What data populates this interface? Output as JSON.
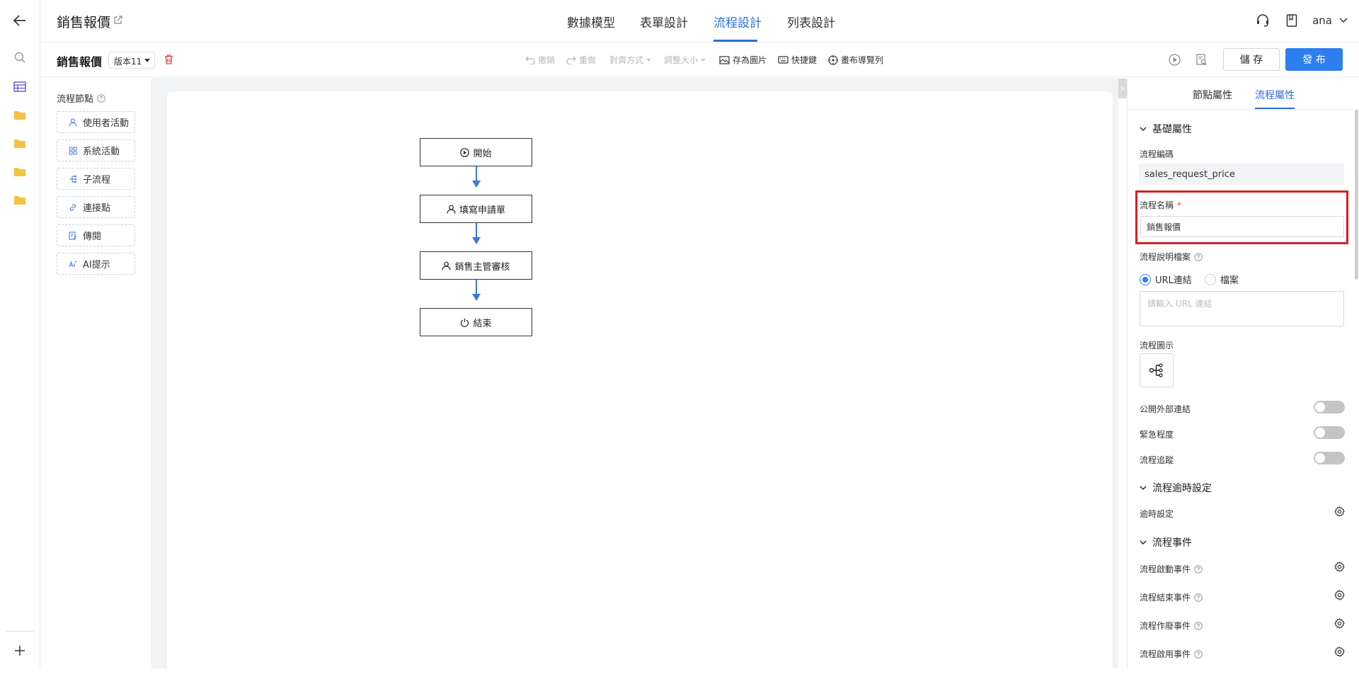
{
  "app": {
    "title": "銷售報價"
  },
  "main_tabs": [
    {
      "label": "數據模型"
    },
    {
      "label": "表單設計"
    },
    {
      "label": "流程設計"
    },
    {
      "label": "列表設計"
    }
  ],
  "user": {
    "name": "ana"
  },
  "toolbar": {
    "doc_title": "銷售報價",
    "version": "版本11",
    "undo": "撤銷",
    "redo": "重做",
    "align": "對齊方式",
    "resize": "調整大小",
    "save_image": "存為圖片",
    "shortcuts": "快捷鍵",
    "canvas_nav": "畫布導覽列",
    "save": "儲 存",
    "publish": "發 布"
  },
  "palette": {
    "title": "流程節點",
    "items": [
      {
        "label": "使用者活動"
      },
      {
        "label": "系統活動"
      },
      {
        "label": "子流程"
      },
      {
        "label": "連接點"
      },
      {
        "label": "傳閱"
      },
      {
        "label": "AI提示"
      }
    ]
  },
  "flow": {
    "nodes": [
      {
        "label": "開始"
      },
      {
        "label": "填寫申請單"
      },
      {
        "label": "銷售主管審核"
      },
      {
        "label": "結束"
      }
    ]
  },
  "panel": {
    "tabs": [
      {
        "label": "節點屬性"
      },
      {
        "label": "流程屬性"
      }
    ],
    "basic_section": "基礎屬性",
    "code_label": "流程編碼",
    "code_value": "sales_request_price",
    "name_label": "流程名稱",
    "name_required": "*",
    "name_value": "銷售報價",
    "doc_label": "流程說明檔案",
    "radio_url": "URL連結",
    "radio_file": "檔案",
    "url_placeholder": "請輸入 URL 連結",
    "icon_label": "流程圖示",
    "public_link": "公開外部連結",
    "urgency": "緊急程度",
    "tracking": "流程追蹤",
    "timeout_section": "流程逾時設定",
    "timeout_setting": "逾時設定",
    "events_section": "流程事件",
    "event_start": "流程啟動事件",
    "event_end": "流程結束事件",
    "event_void": "流程作廢事件",
    "event_enable": "流程啟用事件"
  },
  "colors": {
    "accent": "#2d7ef0",
    "highlight": "#d62020",
    "connector": "#3a78e0"
  }
}
